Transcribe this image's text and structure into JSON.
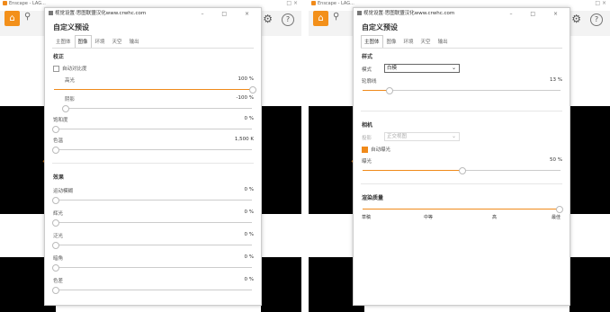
{
  "app": {
    "title": "Enscape - LAG...",
    "home_icon": "home-icon",
    "tool_icon": "tool-icon",
    "gear_icon": "gear-icon",
    "help_label": "?"
  },
  "dialog": {
    "title": "视觉设置·思图联盟汉化www.crwhc.com",
    "subtitle": "自定义预设",
    "window_controls": "– □ ×",
    "tabs": [
      "主图体",
      "图像",
      "环境",
      "天空",
      "输出"
    ]
  },
  "left_panel": {
    "active_tab": "图像",
    "section1": "校正",
    "auto_contrast": "自动对比度",
    "sliders": [
      {
        "label": "高光",
        "value": "100 %",
        "fraction": 1.0
      },
      {
        "label": "阴影",
        "value": "-100 %",
        "fraction": 0.0
      },
      {
        "label": "饱和度",
        "value": "0 %",
        "fraction": 0.0
      },
      {
        "label": "色温",
        "value": "1,500 K",
        "fraction": 0.0
      }
    ],
    "section2": "效果",
    "effects": [
      {
        "label": "运动模糊",
        "value": "0 %",
        "fraction": 0.0
      },
      {
        "label": "辉光",
        "value": "0 %",
        "fraction": 0.0
      },
      {
        "label": "泛光",
        "value": "0 %",
        "fraction": 0.0
      },
      {
        "label": "暗角",
        "value": "0 %",
        "fraction": 0.0
      },
      {
        "label": "色差",
        "value": "0 %",
        "fraction": 0.0
      }
    ]
  },
  "right_panel": {
    "active_tab": "主图体",
    "section1": "样式",
    "mode_label": "模式",
    "mode_value": "白模",
    "outline_label": "轮廓线",
    "outline_value": "13 %",
    "outline_fraction": 0.13,
    "section2": "相机",
    "projection_label": "投影",
    "projection_value": "正交视图",
    "auto_exposure": "自动曝光",
    "exposure_label": "曝光",
    "exposure_value": "50 %",
    "exposure_fraction": 0.5,
    "section3": "渲染质量",
    "quality_fraction": 1.0,
    "quality_levels": [
      "草稿",
      "中等",
      "高",
      "最佳"
    ]
  },
  "colors": {
    "accent": "#f08a1a"
  }
}
